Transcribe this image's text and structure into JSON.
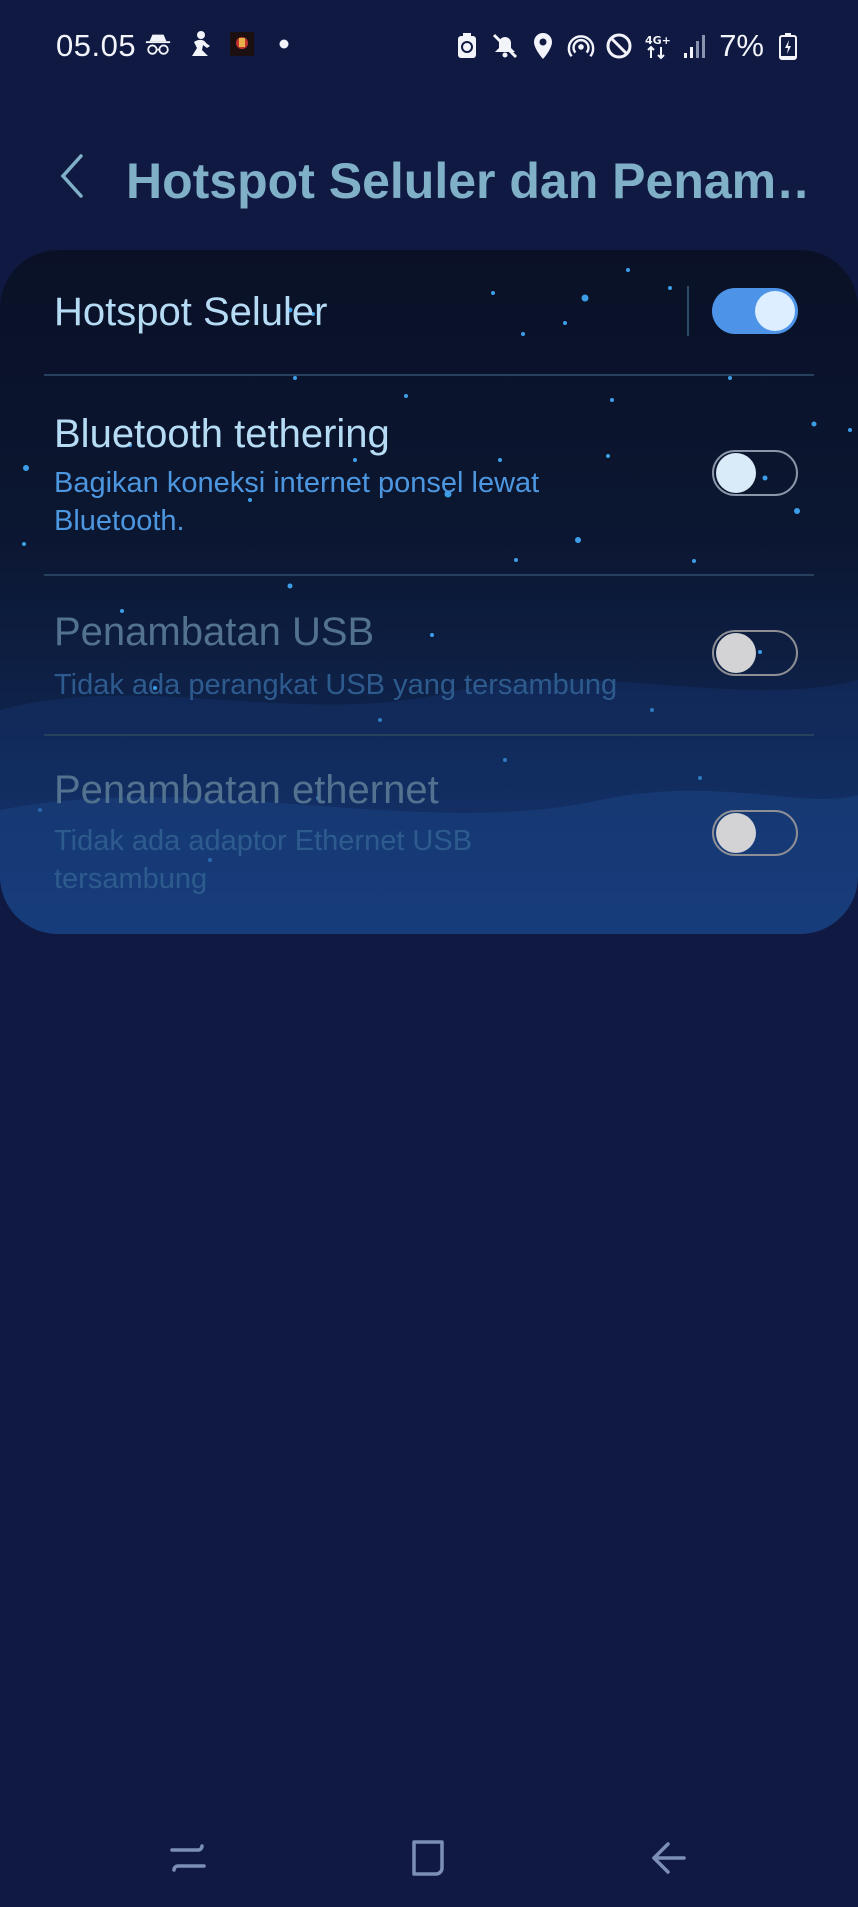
{
  "status_bar": {
    "time": "05.05",
    "battery": "7%",
    "left_icons": [
      "incognito-icon",
      "figure-icon",
      "app-notification-icon",
      "dot-icon"
    ],
    "right_icons": [
      "battery-saver-icon",
      "mute-icon",
      "location-icon",
      "hotspot-icon",
      "block-icon",
      "4g-plus-icon",
      "signal-icon",
      "battery-icon"
    ]
  },
  "header": {
    "title": "Hotspot Seluler dan Penam…"
  },
  "settings": [
    {
      "title": "Hotspot Seluler",
      "subtitle": "",
      "state": "on",
      "enabled": true
    },
    {
      "title": "Bluetooth tethering",
      "subtitle": "Bagikan koneksi internet ponsel lewat Bluetooth.",
      "state": "off",
      "enabled": true
    },
    {
      "title": "Penambatan USB",
      "subtitle": "Tidak ada perangkat USB yang tersambung",
      "state": "off",
      "enabled": false
    },
    {
      "title": "Penambatan ethernet",
      "subtitle": "Tidak ada adaptor Ethernet USB tersambung",
      "state": "off",
      "enabled": false
    }
  ],
  "colors": {
    "background": "#101942",
    "accent": "#4d94e8",
    "title_text": "#7fb0c8"
  },
  "navbar": [
    "recents-icon",
    "home-icon",
    "back-icon"
  ]
}
